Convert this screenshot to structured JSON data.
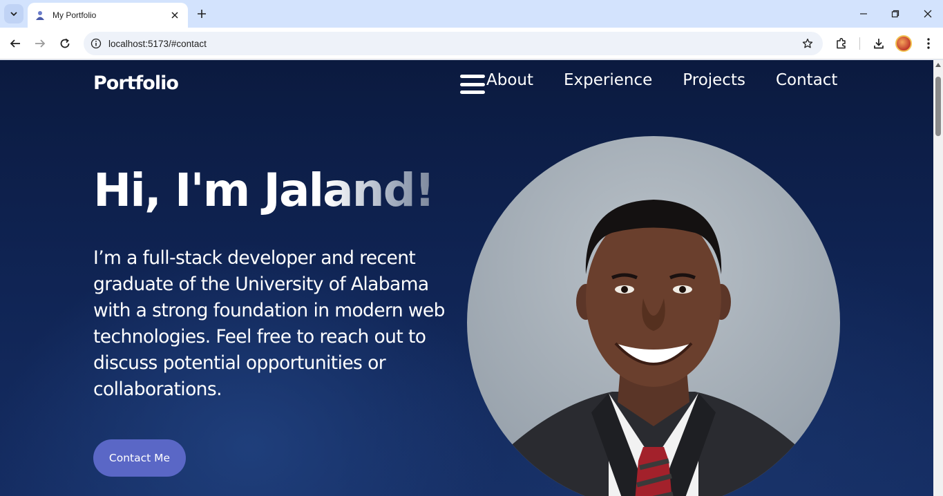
{
  "browser": {
    "tab_title": "My Portfolio",
    "url": "localhost:5173/#contact",
    "icons": [
      "tab-list-icon",
      "portfolio-favicon-icon",
      "close-icon",
      "plus-icon",
      "minimize-icon",
      "restore-icon",
      "close-window-icon",
      "back-icon",
      "forward-icon",
      "reload-icon",
      "info-icon",
      "star-icon",
      "extensions-icon",
      "download-icon",
      "profile-avatar",
      "kebab-menu-icon"
    ]
  },
  "site": {
    "logo": "Portfolio",
    "nav": {
      "items": [
        {
          "label": "About"
        },
        {
          "label": "Experience"
        },
        {
          "label": "Projects"
        },
        {
          "label": "Contact"
        }
      ]
    },
    "hero": {
      "title": "Hi, I'm Jaland!",
      "description": "I’m a full-stack developer and recent graduate of the University of Alabama with a strong foundation in modern web technologies. Feel free to reach out to discuss potential opportunities or collaborations.",
      "cta_label": "Contact Me"
    }
  },
  "colors": {
    "background_top": "#0b1a3f",
    "background_bottom": "#152d63",
    "cta_button": "#5a67c6",
    "portrait_bg": "#a3acb5"
  }
}
